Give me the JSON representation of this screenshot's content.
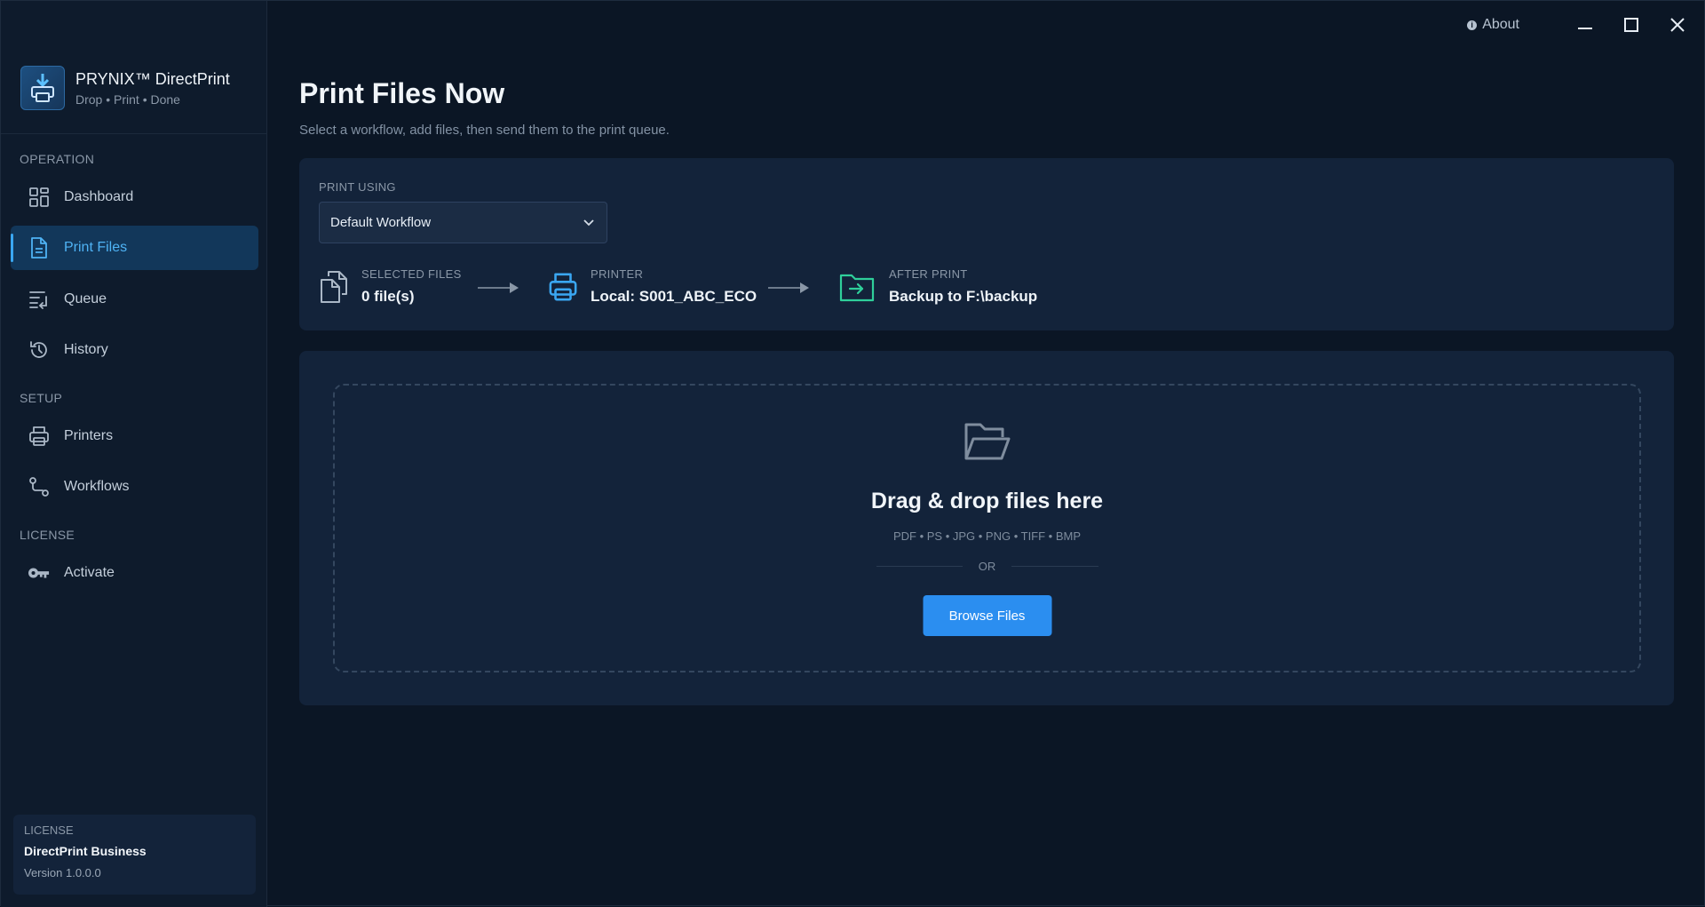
{
  "window": {
    "about_label": "About",
    "minimize_icon": "minimize-icon",
    "maximize_icon": "maximize-icon",
    "close_icon": "close-icon"
  },
  "brand": {
    "name": "PRYNIX™ DirectPrint",
    "tagline": "Drop • Print • Done"
  },
  "sidebar": {
    "sections": {
      "operation": "OPERATION",
      "setup": "SETUP",
      "license": "LICENSE"
    },
    "items": [
      {
        "label": "Dashboard",
        "icon": "dashboard-icon"
      },
      {
        "label": "Print Files",
        "icon": "document-icon",
        "active": true
      },
      {
        "label": "Queue",
        "icon": "queue-icon"
      },
      {
        "label": "History",
        "icon": "history-icon"
      },
      {
        "label": "Printers",
        "icon": "printer-icon"
      },
      {
        "label": "Workflows",
        "icon": "workflow-icon"
      },
      {
        "label": "Activate",
        "icon": "key-icon"
      }
    ],
    "license_card": {
      "label": "LICENSE",
      "name": "DirectPrint Business",
      "version": "Version 1.0.0.0"
    }
  },
  "main": {
    "title": "Print Files Now",
    "subtitle": "Select a workflow, add files, then send them to the print queue.",
    "print_using": {
      "label": "PRINT USING",
      "selected": "Default Workflow"
    },
    "flow": {
      "selected_files": {
        "label": "SELECTED FILES",
        "value": "0 file(s)"
      },
      "printer": {
        "label": "PRINTER",
        "value": "Local: S001_ABC_ECO"
      },
      "after_print": {
        "label": "AFTER PRINT",
        "value": "Backup to F:\\backup"
      }
    },
    "dropzone": {
      "title": "Drag & drop files here",
      "formats": "PDF • PS • JPG • PNG • TIFF • BMP",
      "or": "OR",
      "browse_label": "Browse Files"
    }
  },
  "colors": {
    "accent": "#2b8ef0",
    "active_nav": "#4fb3f5",
    "after_print_icon": "#2fcf9a",
    "background": "#0b1625"
  }
}
